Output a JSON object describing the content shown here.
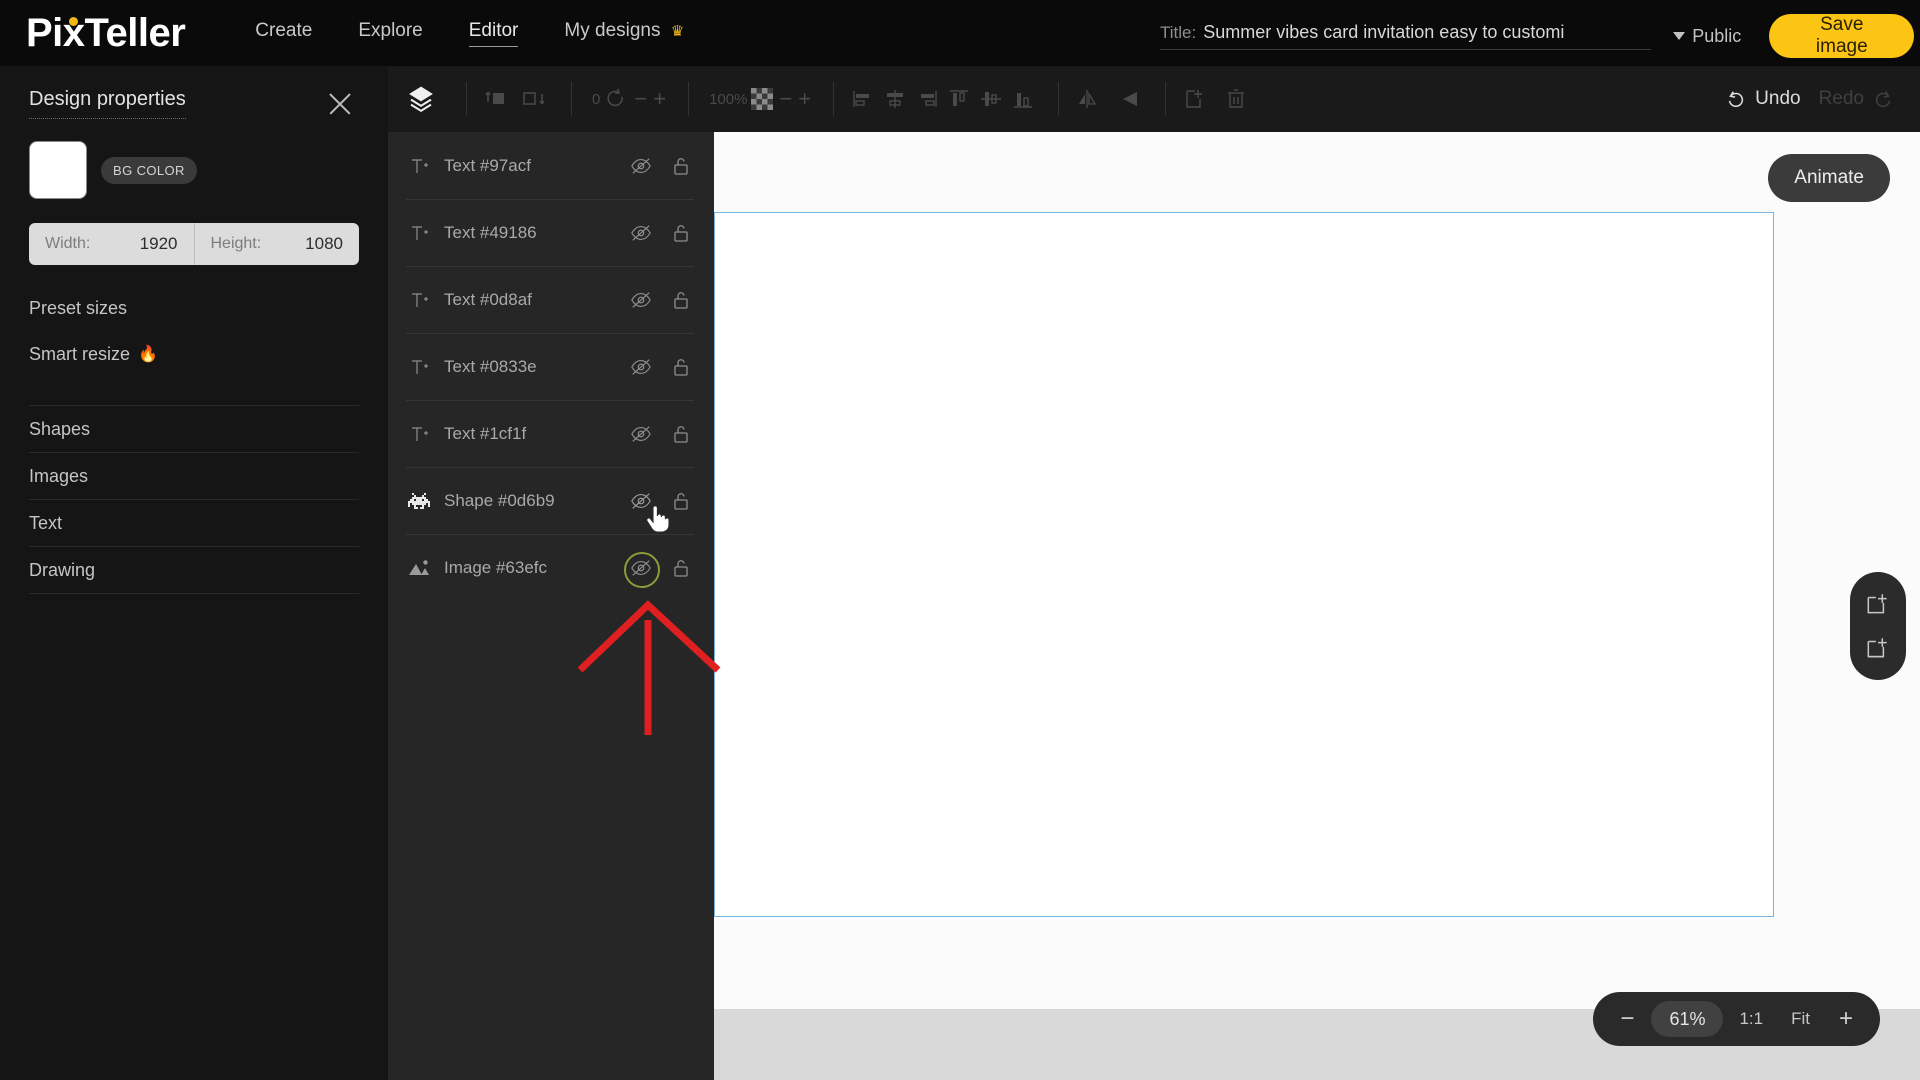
{
  "brand": {
    "name": "PixTeller"
  },
  "nav": {
    "items": [
      {
        "label": "Create",
        "active": false
      },
      {
        "label": "Explore",
        "active": false
      },
      {
        "label": "Editor",
        "active": true
      },
      {
        "label": "My designs",
        "active": false,
        "badge": "crown-icon"
      }
    ]
  },
  "header": {
    "title_label": "Title:",
    "title_value": "Summer vibes card invitation easy to customi",
    "visibility": "Public",
    "save_label": "Save image",
    "menu_icon": "hamburger-icon"
  },
  "design_properties": {
    "heading": "Design properties",
    "close_icon": "close-icon",
    "bg_color_label": "BG COLOR",
    "bg_color_value": "#ffffff",
    "width_label": "Width:",
    "width_value": "1920",
    "height_label": "Height:",
    "height_value": "1080",
    "menu": [
      {
        "label": "Preset sizes",
        "flame": ""
      },
      {
        "label": "Smart resize",
        "flame": "🔥"
      },
      {
        "label": "Shapes",
        "flame": ""
      },
      {
        "label": "Images",
        "flame": ""
      },
      {
        "label": "Text",
        "flame": ""
      },
      {
        "label": "Drawing",
        "flame": ""
      }
    ]
  },
  "toolbar": {
    "layers_icon": "layers-icon",
    "bring_forward_icon": "bring-forward-icon",
    "send_backward_icon": "send-backward-icon",
    "rotation_value": "0",
    "rotation_icon": "rotate-icon",
    "rotation_minus": "−",
    "rotation_plus": "+",
    "opacity_value": "100%",
    "opacity_icon": "checker-icon",
    "opacity_minus": "−",
    "opacity_plus": "+",
    "align_left_icon": "align-left-icon",
    "align_center_icon": "align-center-icon",
    "align_right_icon": "align-right-icon",
    "align_top_icon": "align-top-icon",
    "align_middle_icon": "align-middle-icon",
    "align_bottom_icon": "align-bottom-icon",
    "flip_h_icon": "flip-horizontal-icon",
    "flip_v_icon": "flip-vertical-icon",
    "duplicate_icon": "duplicate-icon",
    "delete_icon": "trash-icon",
    "undo_label": "Undo",
    "redo_label": "Redo"
  },
  "layers": [
    {
      "type": "Text",
      "name": "Text #97acf",
      "icon": "text-layer-icon",
      "hidden": true,
      "locked": false,
      "highlighted": false
    },
    {
      "type": "Text",
      "name": "Text #49186",
      "icon": "text-layer-icon",
      "hidden": true,
      "locked": false,
      "highlighted": false
    },
    {
      "type": "Text",
      "name": "Text #0d8af",
      "icon": "text-layer-icon",
      "hidden": true,
      "locked": false,
      "highlighted": false
    },
    {
      "type": "Text",
      "name": "Text #0833e",
      "icon": "text-layer-icon",
      "hidden": true,
      "locked": false,
      "highlighted": false
    },
    {
      "type": "Text",
      "name": "Text #1cf1f",
      "icon": "text-layer-icon",
      "hidden": true,
      "locked": false,
      "highlighted": false
    },
    {
      "type": "Shape",
      "name": "Shape #0d6b9",
      "icon": "invader-shape-icon",
      "hidden": true,
      "locked": false,
      "highlighted": false
    },
    {
      "type": "Image",
      "name": "Image #63efc",
      "icon": "image-layer-icon",
      "hidden": true,
      "locked": false,
      "highlighted": true
    }
  ],
  "canvas": {
    "animate_label": "Animate",
    "add_page_icon": "add-page-icon",
    "duplicate_page_icon": "duplicate-page-icon"
  },
  "zoom_controls": {
    "minus": "−",
    "percent": "61%",
    "one_to_one": "1:1",
    "fit": "Fit",
    "plus": "+"
  },
  "colors": {
    "accent_yellow": "#fdc513",
    "canvas_border_blue": "#7bb8e0",
    "highlight_green": "#8f9b3a",
    "annotation_red": "#e02020"
  }
}
